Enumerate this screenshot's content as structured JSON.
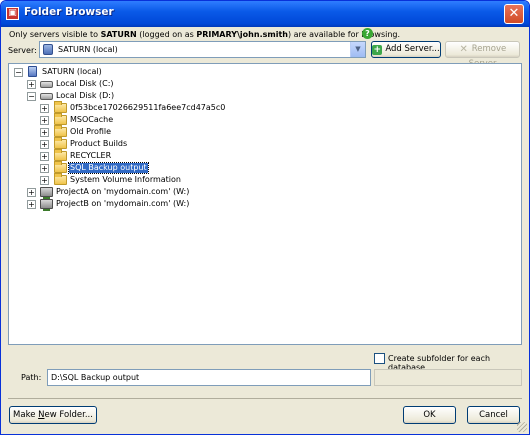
{
  "window": {
    "title": "Folder Browser",
    "close_glyph": "✕"
  },
  "info": {
    "prefix": "Only servers visible to ",
    "server": "SATURN",
    "middle": " (logged on as ",
    "account": "PRIMARY\\john.smith",
    "suffix": ") are available for browsing."
  },
  "server": {
    "label": "Server:",
    "value": "SATURN (local)",
    "add_button": "Add Server...",
    "remove_button": "Remove Server"
  },
  "tree": {
    "root": "SATURN (local)",
    "drive_c": "Local Disk (C:)",
    "drive_d": "Local Disk (D:)",
    "folders": [
      "0f53bce17026629511fa6ee7cd47a5c0",
      "MSOCache",
      "Old Profile",
      "Product Builds",
      "RECYCLER",
      "SQL Backup output",
      "System Volume Information"
    ],
    "selected_folder": "SQL Backup output",
    "share_a": "ProjectA on 'mydomain.com' (W:)",
    "share_b": "ProjectB on 'mydomain.com' (W:)"
  },
  "options": {
    "create_subfolder_label": "Create subfolder for each database",
    "create_subfolder_checked": false
  },
  "path": {
    "label": "Path:",
    "value": "D:\\SQL Backup output"
  },
  "footer": {
    "new_folder_prefix": "Make ",
    "new_folder_mnemonic": "N",
    "new_folder_suffix": "ew Folder...",
    "ok": "OK",
    "cancel": "Cancel"
  },
  "icons": {
    "app": "folder-browser-app-icon",
    "help": "help-icon",
    "expand": "plus-expander-icon",
    "collapse": "minus-expander-icon"
  }
}
